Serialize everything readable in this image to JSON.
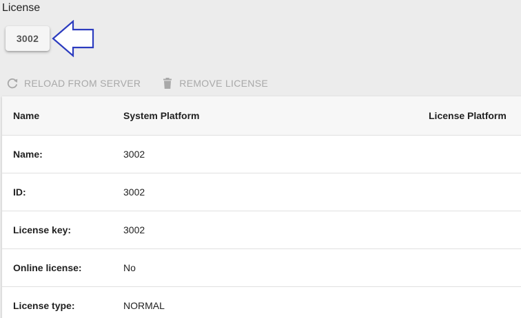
{
  "section": {
    "title": "License"
  },
  "chip": {
    "label": "3002"
  },
  "toolbar": {
    "reload_label": "RELOAD FROM SERVER",
    "remove_label": "REMOVE LICENSE",
    "reload_icon": "refresh-icon",
    "remove_icon": "trash-icon"
  },
  "table": {
    "columns": [
      "Name",
      "System Platform",
      "License Platform"
    ],
    "rows": [
      {
        "name": "Name:",
        "system": "3002",
        "license": ""
      },
      {
        "name": "ID:",
        "system": "3002",
        "license": ""
      },
      {
        "name": "License key:",
        "system": "3002",
        "license": ""
      },
      {
        "name": "Online license:",
        "system": "No",
        "license": ""
      },
      {
        "name": "License type:",
        "system": "NORMAL",
        "license": ""
      }
    ]
  },
  "colors": {
    "background": "#ececec",
    "arrow": "#2b3bbf",
    "disabled_text": "#a8a8a8"
  }
}
